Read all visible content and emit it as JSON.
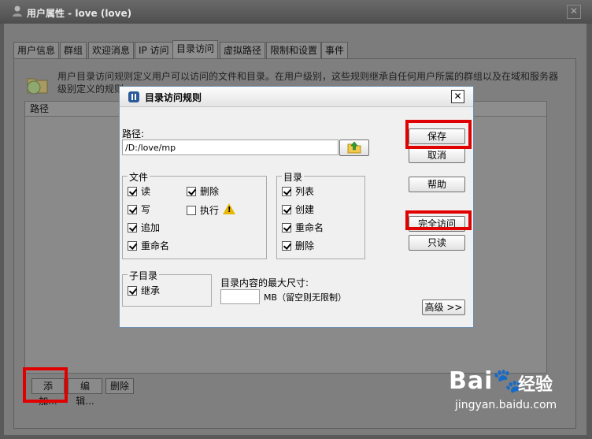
{
  "outer_window": {
    "title": "用户属性 - love (love)",
    "close_glyph": "✕",
    "tabs": [
      {
        "label": "用户信息",
        "active": false
      },
      {
        "label": "群组",
        "active": false
      },
      {
        "label": "欢迎消息",
        "active": false
      },
      {
        "label": "IP 访问",
        "active": false
      },
      {
        "label": "目录访问",
        "active": true
      },
      {
        "label": "虚拟路径",
        "active": false
      },
      {
        "label": "限制和设置",
        "active": false
      },
      {
        "label": "事件",
        "active": false
      }
    ],
    "description": "用户目录访问规则定义用户可以访问的文件和目录。在用户级别，这些规则继承自任何用户所属的群组以及在域和服务器级别定义的规则。",
    "list_header": "路径",
    "add_button": "添加...",
    "edit_button": "编辑...",
    "delete_button": "删除"
  },
  "dialog": {
    "title": "目录访问规则",
    "close_glyph": "✕",
    "path_label": "路径:",
    "path_value": "/D:/love/mp",
    "browse_icon": "folder-up-icon",
    "files_group": {
      "label": "文件",
      "read": {
        "label": "读",
        "checked": true
      },
      "write": {
        "label": "写",
        "checked": true
      },
      "append": {
        "label": "追加",
        "checked": true
      },
      "rename": {
        "label": "重命名",
        "checked": true
      },
      "delete": {
        "label": "删除",
        "checked": true
      },
      "execute": {
        "label": "执行",
        "checked": false
      }
    },
    "dirs_group": {
      "label": "目录",
      "list": {
        "label": "列表",
        "checked": true
      },
      "create": {
        "label": "创建",
        "checked": true
      },
      "rename": {
        "label": "重命名",
        "checked": true
      },
      "delete": {
        "label": "删除",
        "checked": true
      }
    },
    "subdir_group": {
      "label": "子目录",
      "inherit": {
        "label": "继承",
        "checked": true
      }
    },
    "max_size_label": "目录内容的最大尺寸:",
    "max_size_value": "",
    "mb_hint": "MB（留空则无限制）",
    "buttons": {
      "save": "保存",
      "cancel": "取消",
      "help": "帮助",
      "full_access": "完全访问",
      "read_only": "只读",
      "advanced": "高级 >>"
    }
  },
  "watermark": {
    "logo": "Bai🐾",
    "brand": "经验",
    "site": "jingyan.baidu.com"
  },
  "colors": {
    "highlight_box": "#e00000",
    "dialog_border": "#6f8fb0",
    "warning": "#e8b800"
  }
}
